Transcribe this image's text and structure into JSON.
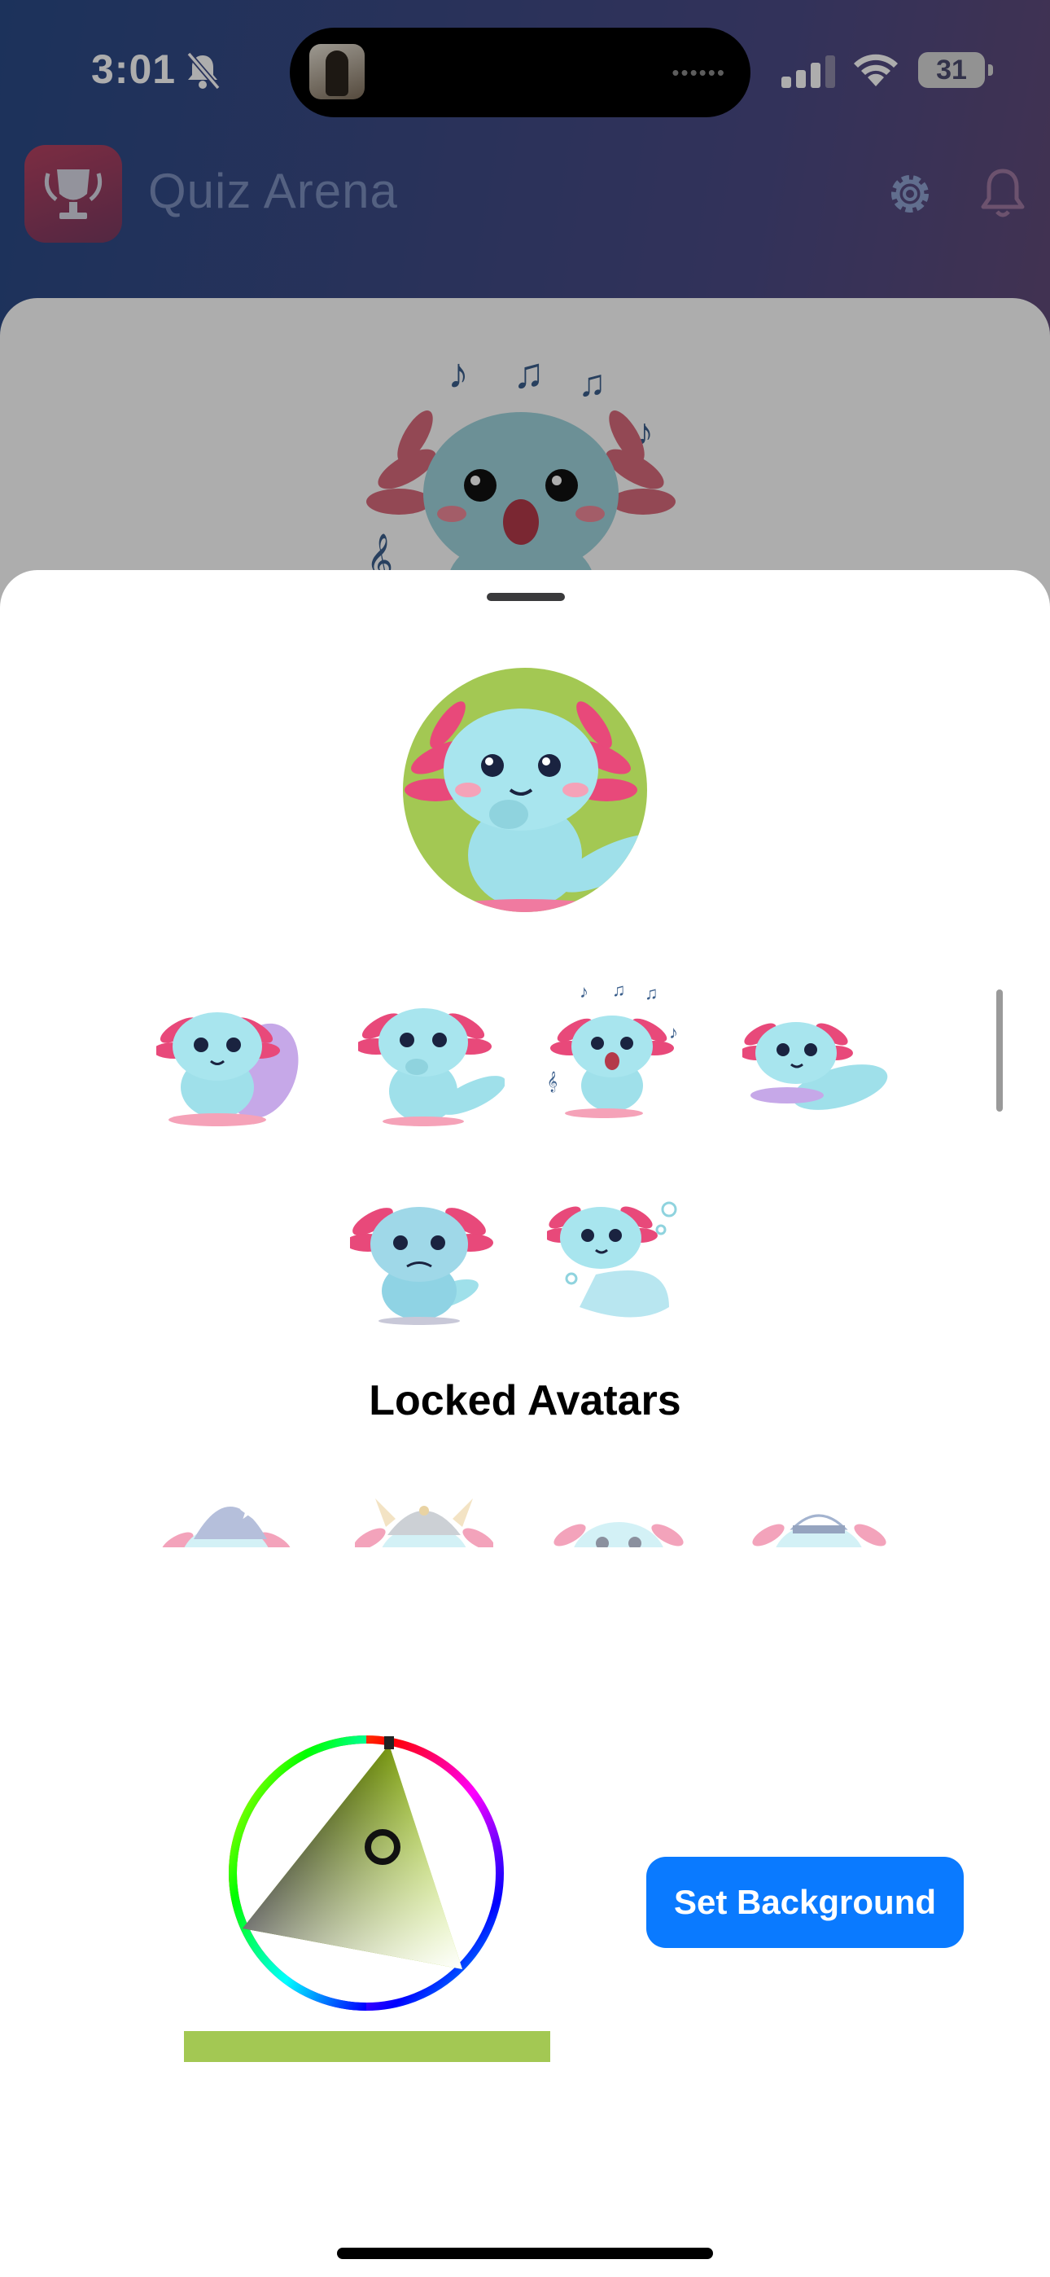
{
  "status_bar": {
    "time": "3:01",
    "battery": "31"
  },
  "header": {
    "title": "Quiz Arena"
  },
  "avatar_picker": {
    "unlocked_avatars": [
      {
        "name": "axolotl-waving"
      },
      {
        "name": "axolotl-thinking"
      },
      {
        "name": "axolotl-singing"
      },
      {
        "name": "axolotl-lying"
      },
      {
        "name": "axolotl-grumpy"
      },
      {
        "name": "axolotl-swimming"
      }
    ],
    "locked_title": "Locked Avatars",
    "locked_avatars": [
      {
        "name": "axolotl-wizard"
      },
      {
        "name": "axolotl-viking"
      },
      {
        "name": "axolotl-plain"
      },
      {
        "name": "axolotl-sailor"
      }
    ],
    "selected_background_color": "#a3c853",
    "set_background_label": "Set Background"
  },
  "colors": {
    "accent": "#0a7aff",
    "header_gradient_start": "#2a4a86",
    "header_gradient_end": "#7a4a6c",
    "axolotl_body": "#9fe0ea",
    "axolotl_gills": "#e8497a"
  }
}
